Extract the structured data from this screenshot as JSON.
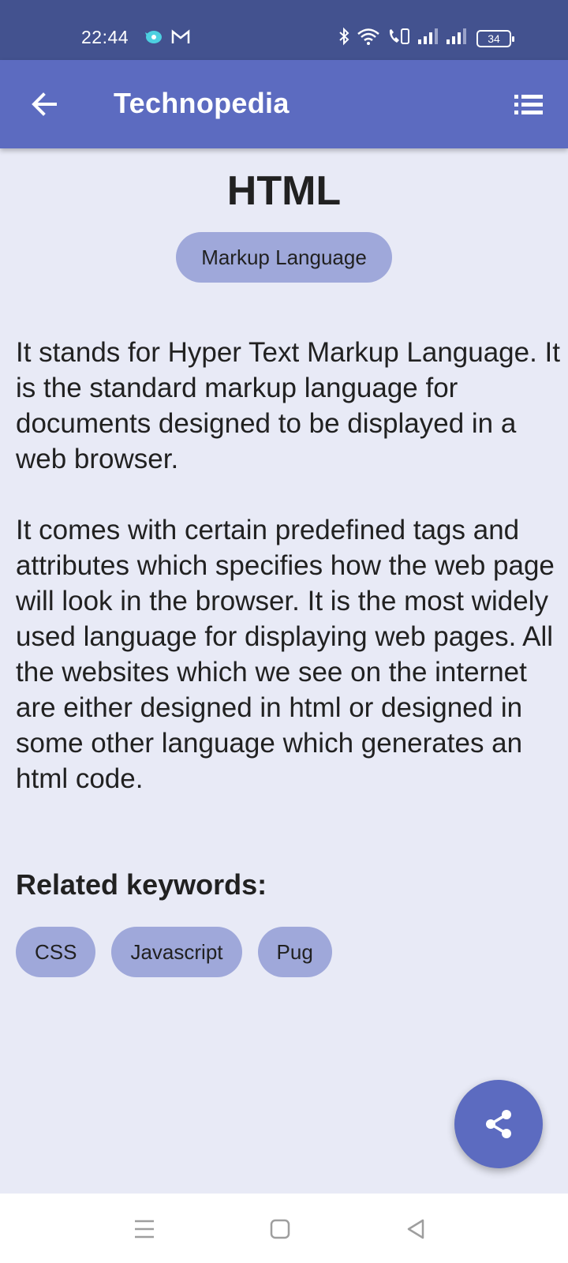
{
  "status_bar": {
    "time": "22:44",
    "battery_level": "34",
    "left_icons": [
      "messenger-icon",
      "gmail-icon"
    ],
    "right_icons": [
      "bluetooth-icon",
      "wifi-icon",
      "volte-call-icon",
      "signal-icon",
      "signal-icon"
    ]
  },
  "app_bar": {
    "title": "Technopedia",
    "back_icon": "arrow-left-icon",
    "menu_icon": "list-icon",
    "color": "#5c6bc0"
  },
  "topic": {
    "title": "HTML",
    "category": "Markup Language",
    "description": "It stands for Hyper Text Markup Language. It is the standard markup language for documents designed to be displayed in a web browser.\n\nIt comes with certain predefined tags and attributes which specifies how the web page will look in the browser. It is the most widely used language for displaying web pages. All the websites which we see on the internet are either designed in html or designed in some other language which generates an html code."
  },
  "related": {
    "heading": "Related keywords:",
    "keywords": [
      "CSS",
      "Javascript",
      "Pug"
    ]
  },
  "fab": {
    "icon": "share-icon"
  },
  "navigation_bar": {
    "buttons": [
      "recent-apps-icon",
      "home-icon",
      "back-icon"
    ]
  },
  "colors": {
    "status_bar": "#43528f",
    "accent": "#5c6bc0",
    "chip": "#9fa8da",
    "background": "#e8eaf6"
  }
}
